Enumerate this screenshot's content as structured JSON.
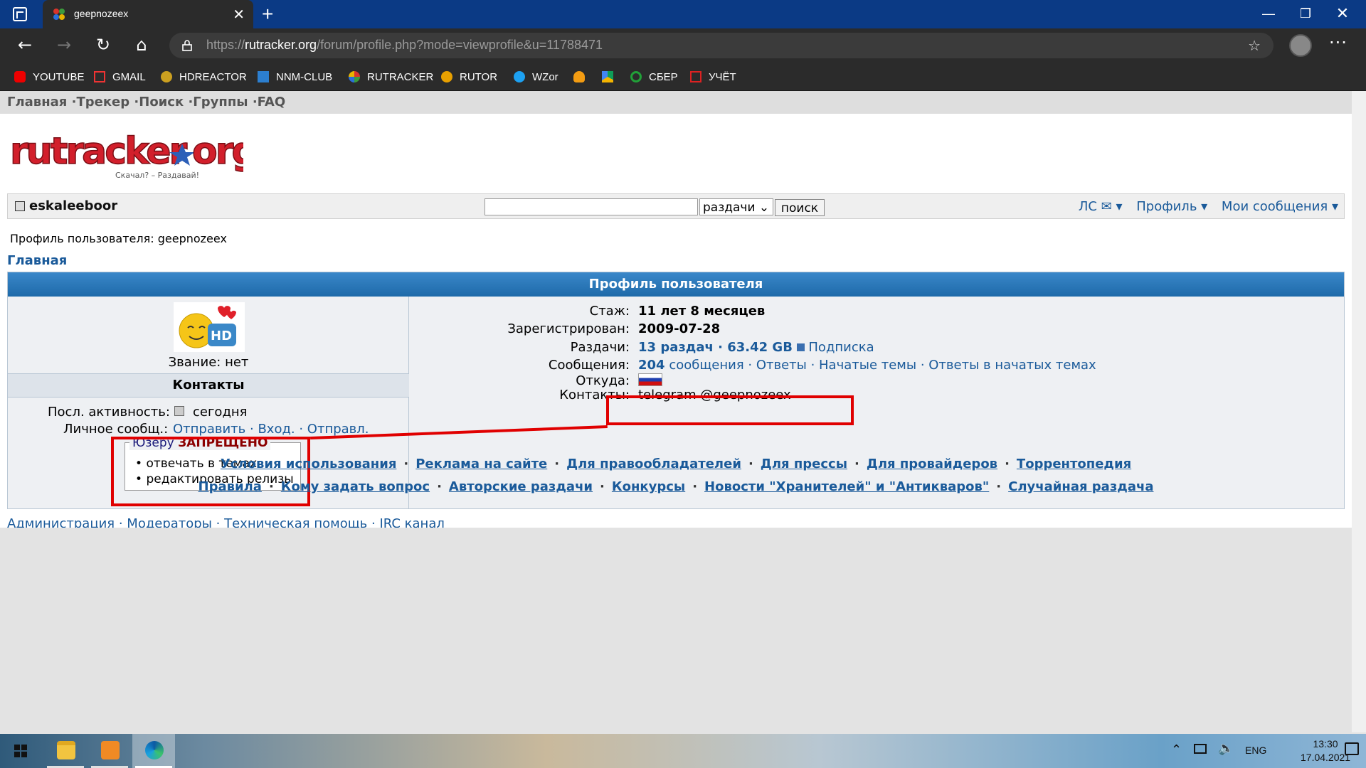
{
  "browser": {
    "tab_title": "geepnozeex",
    "url_prefix": "https://",
    "url_host": "rutracker.org",
    "url_path": "/forum/profile.php?mode=viewprofile&u=11788471",
    "bookmarks": [
      "YOUTUBE",
      "GMAIL",
      "HDREACTOR",
      "NNM-CLUB",
      "RUTRACKER",
      "RUTOR",
      "WZor",
      "",
      "",
      "СБЕР",
      "УЧЁТ"
    ]
  },
  "site": {
    "top_nav": [
      "Главная",
      "Трекер",
      "Поиск",
      "Группы",
      "FAQ"
    ],
    "logo_tagline": "Скачал? – Раздавай!",
    "username": "eskaleeboor",
    "search": {
      "select_value": "раздачи",
      "button": "поиск"
    },
    "user_menu": [
      "ЛС ✉ ▾",
      "Профиль ▾",
      "Мои сообщения ▾"
    ],
    "breadcrumb_label": "Профиль пользователя: geepnozeex",
    "breadcrumb_home": "Главная"
  },
  "profile": {
    "header": "Профиль пользователя",
    "rank": "Звание: нет",
    "contacts_head": "Контакты",
    "activity_label": "Посл. активность:",
    "activity_value": "сегодня",
    "pm_label": "Личное сообщ.:",
    "pm_links": "Отправить · Вход. · Отправл.",
    "ban_who": "Юзеру ",
    "ban_word": "ЗАПРЕЩЕНО",
    "ban_items": [
      "отвечать в темах",
      "редактировать релизы"
    ],
    "stazh_label": "Стаж:",
    "stazh_value": "11 лет 8 месяцев",
    "reg_label": "Зарегистрирован:",
    "reg_value": "2009-07-28",
    "razdachi_label": "Раздачи:",
    "razdachi_value": "13 раздач · 63.42 GB",
    "podpiska": "Подписка",
    "soobsh_label": "Сообщения:",
    "soobsh_count": "204",
    "soobsh_links": "сообщения · Ответы · Начатые темы · Ответы в начатых темах",
    "otkuda_label": "Откуда:",
    "contacts_label": "Контакты:",
    "contacts_value": "telegram @geepnozeex"
  },
  "footer": {
    "row1": [
      "Условия использования",
      "Реклама на сайте",
      "Для правообладателей",
      "Для прессы",
      "Для провайдеров",
      "Торрентопедия"
    ],
    "row2": [
      "Правила",
      "Кому задать вопрос",
      "Авторские раздачи",
      "Конкурсы",
      "Новости \"Хранителей\" и \"Антикваров\"",
      "Случайная раздача"
    ],
    "bottom": "Администрация · Модераторы · Техническая помощь · IRC канал"
  },
  "taskbar": {
    "lang": "ENG",
    "time": "13:30",
    "date": "17.04.2021"
  },
  "colors": {
    "link": "#1a5a9a",
    "highlight": "#e00000",
    "header_blue": "#1e6aa9"
  }
}
